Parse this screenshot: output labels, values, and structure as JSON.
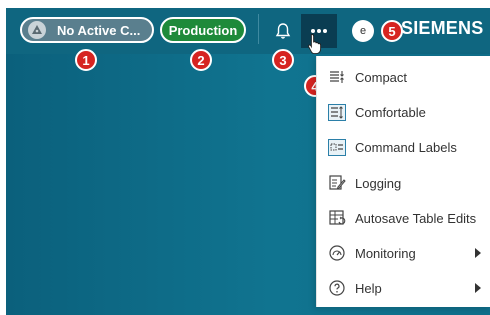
{
  "header": {
    "context_pill": "No Active C...",
    "environment_pill": "Production",
    "avatar_letter": "e",
    "logo": "SIEMENS"
  },
  "badges": [
    "1",
    "2",
    "3",
    "4",
    "5"
  ],
  "menu": {
    "items": [
      {
        "label": "Compact",
        "icon": "compact-density-icon"
      },
      {
        "label": "Comfortable",
        "icon": "comfortable-density-icon"
      },
      {
        "label": "Command Labels",
        "icon": "command-labels-icon"
      },
      {
        "label": "Logging",
        "icon": "logging-icon"
      },
      {
        "label": "Autosave Table Edits",
        "icon": "autosave-table-icon"
      },
      {
        "label": "Monitoring",
        "icon": "monitoring-icon",
        "submenu": true
      },
      {
        "label": "Help",
        "icon": "help-icon",
        "submenu": true
      }
    ]
  },
  "colors": {
    "header_bg": "#0f6680",
    "environment": "#1e8a3a",
    "badge": "#d62421",
    "active_button": "#0a3d52"
  }
}
